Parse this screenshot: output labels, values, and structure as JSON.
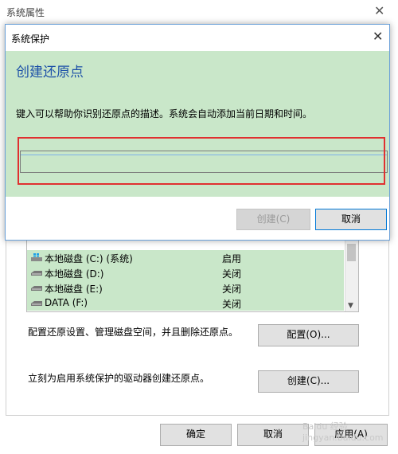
{
  "back_window": {
    "title": "系统属性",
    "drives": [
      {
        "name": "本地磁盘 (C:) (系统)",
        "state": "启用",
        "icon": "windows-drive-icon"
      },
      {
        "name": "本地磁盘 (D:)",
        "state": "关闭",
        "icon": "drive-icon"
      },
      {
        "name": "本地磁盘 (E:)",
        "state": "关闭",
        "icon": "drive-icon"
      },
      {
        "name": "DATA (F:)",
        "state": "关闭",
        "icon": "drive-icon"
      }
    ],
    "config_desc": "配置还原设置、管理磁盘空间，并且删除还原点。",
    "config_button": "配置(O)...",
    "create_desc": "立刻为启用系统保护的驱动器创建还原点。",
    "create_button": "创建(C)...",
    "ok_button": "确定",
    "cancel_button": "取消",
    "apply_button": "应用(A)"
  },
  "dialog": {
    "title": "系统保护",
    "heading": "创建还原点",
    "instruction": "键入可以帮助你识别还原点的描述。系统会自动添加当前日期和时间。",
    "input_value": "",
    "create_button": "创建(C)",
    "cancel_button": "取消"
  },
  "watermark": "Baidu 经验  jingyan.baidu.com"
}
